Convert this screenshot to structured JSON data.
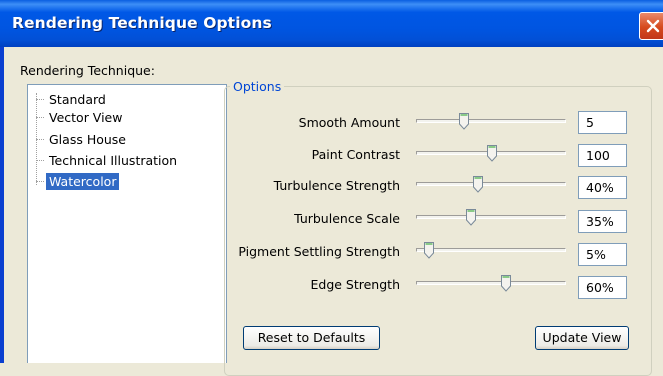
{
  "window": {
    "title": "Rendering Technique Options"
  },
  "technique": {
    "label": "Rendering Technique:",
    "items": [
      {
        "label": "Standard",
        "selected": false
      },
      {
        "label": "Vector View",
        "selected": false
      },
      {
        "label": "Glass House",
        "selected": false
      },
      {
        "label": "Technical Illustration",
        "selected": false
      },
      {
        "label": "Watercolor",
        "selected": true
      }
    ]
  },
  "options": {
    "title": "Options",
    "rows": [
      {
        "label": "Smooth Amount",
        "value": "5",
        "slider_fraction": 0.3
      },
      {
        "label": "Paint Contrast",
        "value": "100",
        "slider_fraction": 0.5
      },
      {
        "label": "Turbulence Strength",
        "value": "40%",
        "slider_fraction": 0.4
      },
      {
        "label": "Turbulence Scale",
        "value": "35%",
        "slider_fraction": 0.35
      },
      {
        "label": "Pigment Settling Strength",
        "value": "5%",
        "slider_fraction": 0.05
      },
      {
        "label": "Edge Strength",
        "value": "60%",
        "slider_fraction": 0.6
      }
    ]
  },
  "buttons": {
    "reset": "Reset to Defaults",
    "update": "Update View"
  },
  "colors": {
    "title_bar": "#0058e6",
    "selection": "#316ac5",
    "group_title": "#0046d5"
  }
}
